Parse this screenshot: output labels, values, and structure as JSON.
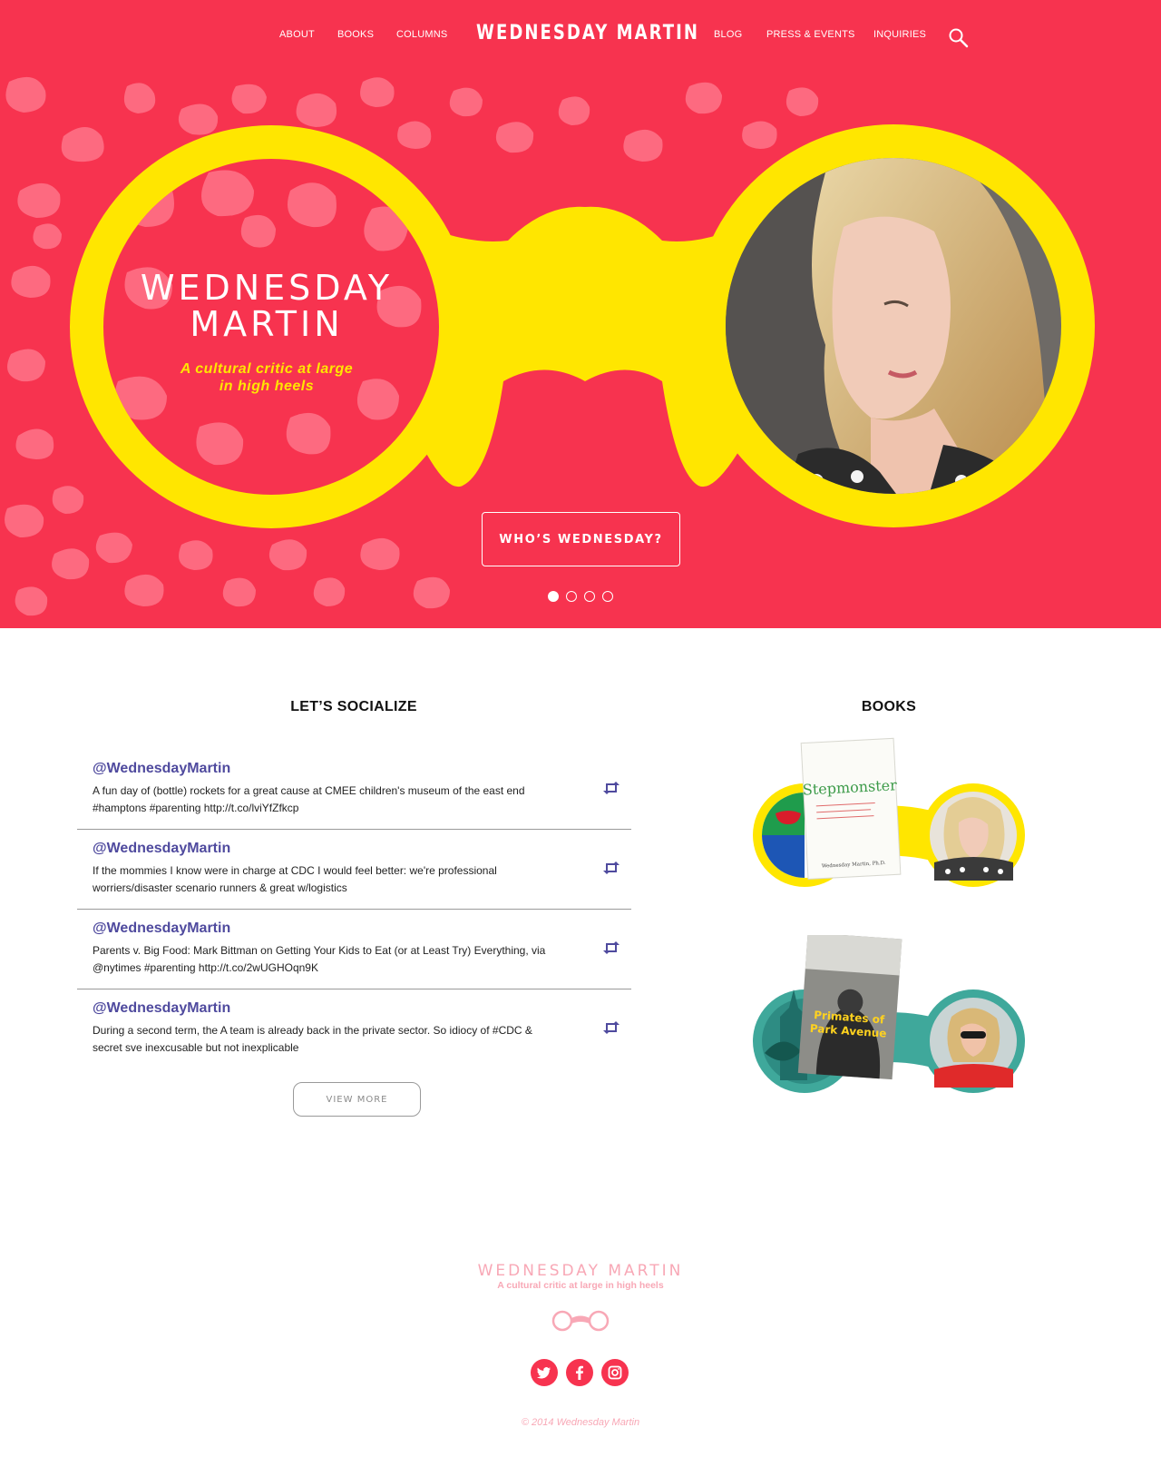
{
  "nav": {
    "left_items": [
      {
        "label": "ABOUT"
      },
      {
        "label": "BOOKS"
      },
      {
        "label": "COLUMNS"
      }
    ],
    "brand": "WEDNESDAY MARTIN",
    "right_items": [
      {
        "label": "BLOG"
      },
      {
        "label": "PRESS & EVENTS"
      },
      {
        "label": "INQUIRIES"
      }
    ],
    "search_icon": "search-icon"
  },
  "hero": {
    "title_line1": "WEDNESDAY",
    "title_line2": "MARTIN",
    "tagline_line1": "A cultural critic at large",
    "tagline_line2": "in high heels",
    "cta_label": "WHO’S WEDNESDAY?",
    "slides_total": 4,
    "active_slide": 1,
    "colors": {
      "background": "#f7334f",
      "pattern": "#fd6a80",
      "glasses": "#ffe600"
    }
  },
  "social": {
    "title": "LET’S SOCIALIZE",
    "tweets": [
      {
        "handle": "@WednesdayMartin",
        "text": "A fun day of (bottle) rockets for a great cause at CMEE children's museum of the east end #hamptons #parenting http://t.co/lviYfZfkcp"
      },
      {
        "handle": "@WednesdayMartin",
        "text": "If the mommies I know were in charge at CDC I would feel better: we're professional worriers/disaster scenario runners & great w/logistics"
      },
      {
        "handle": "@WednesdayMartin",
        "text": "Parents v. Big Food: Mark Bittman on Getting Your Kids to Eat (or at Least Try) Everything, via @nytimes #parenting http://t.co/2wUGHOqn9K"
      },
      {
        "handle": "@WednesdayMartin",
        "text": "During a second term, the A team is already back in the private sector. So idiocy of #CDC & secret sve inexcusable but not inexplicable"
      }
    ],
    "view_more_label": "VIEW MORE",
    "handle_color": "#4f4a9e"
  },
  "books": {
    "title": "BOOKS",
    "items": [
      {
        "cover_title": "Stepmonster",
        "cover_author": "Wednesday Martin, Ph.D.",
        "frame_color": "#ffe600"
      },
      {
        "cover_title_line1": "Primates of",
        "cover_title_line2": "Park Avenue",
        "frame_color": "#3fa89b"
      }
    ]
  },
  "footer": {
    "brand": "WEDNESDAY MARTIN",
    "tagline": "A cultural critic at large in high heels",
    "social_icons": [
      "twitter-icon",
      "facebook-icon",
      "instagram-icon"
    ],
    "copyright": "© 2014 Wednesday Martin",
    "accent": "#f8a8b6"
  }
}
